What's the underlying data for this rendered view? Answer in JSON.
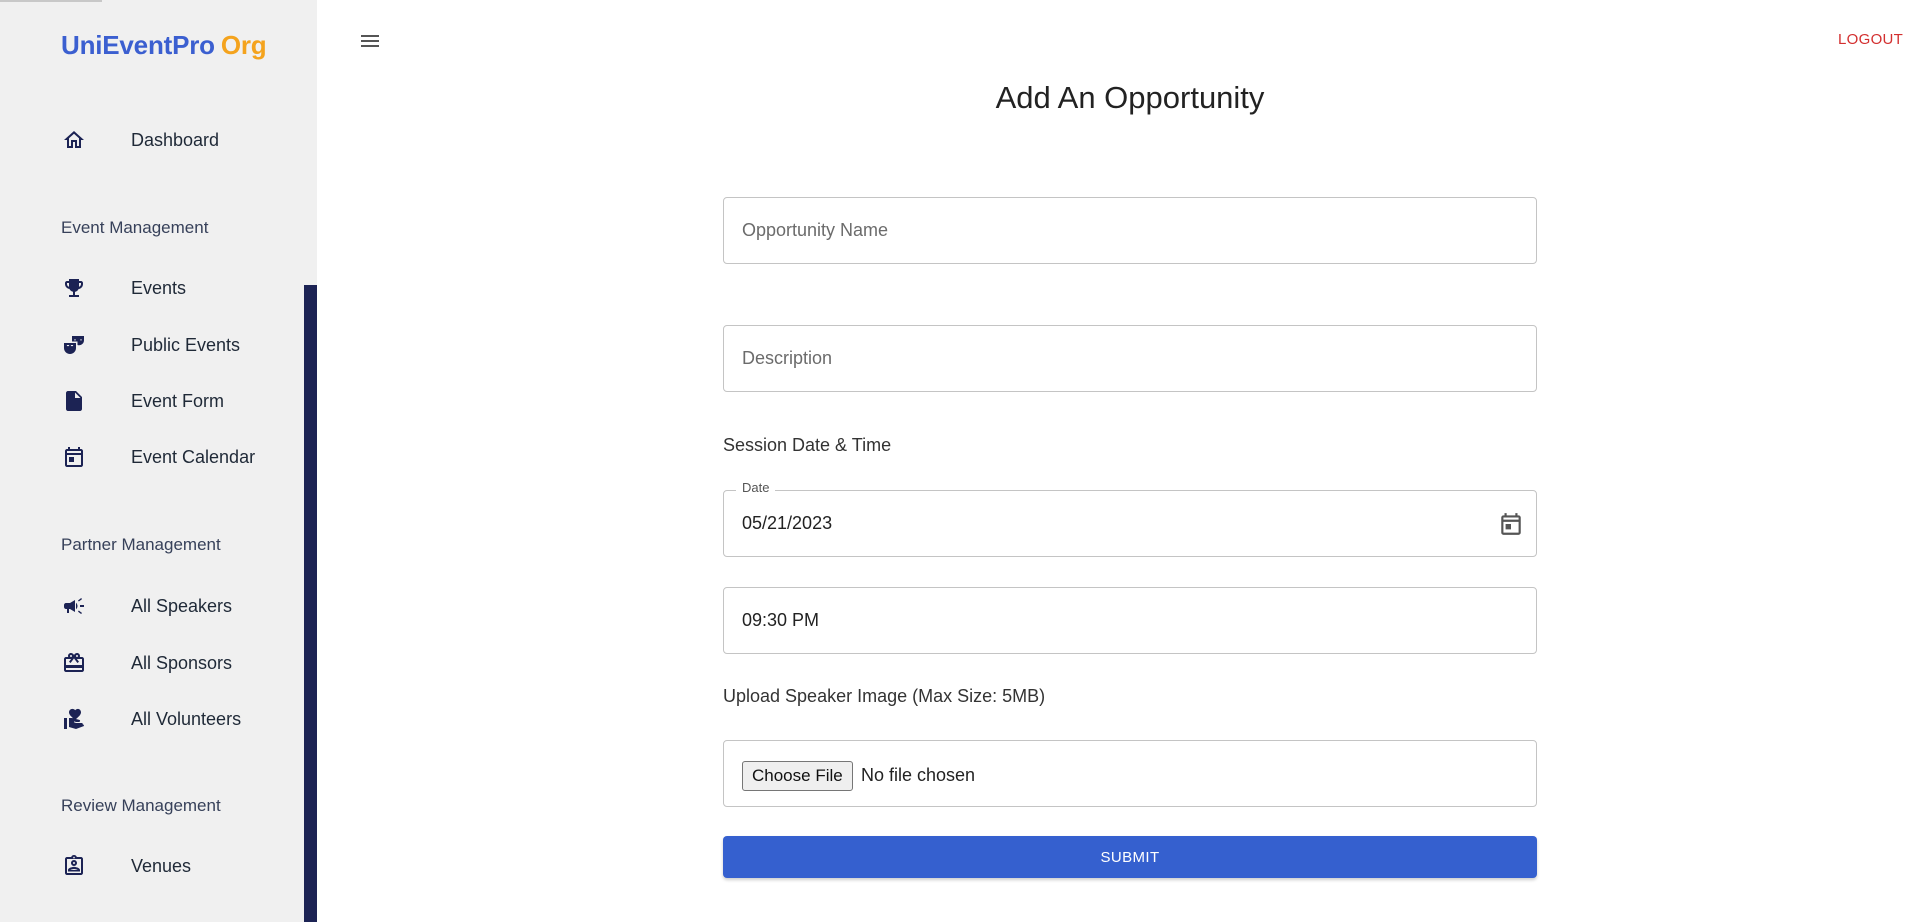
{
  "brand": {
    "name": "UniEventPro",
    "suffix": "Org",
    "name_color": "#3b5fd0",
    "suffix_color": "#f4a31d"
  },
  "sidebar": {
    "dashboard": {
      "label": "Dashboard",
      "icon": "home-icon"
    },
    "sections": [
      {
        "title": "Event Management",
        "items": [
          {
            "label": "Events",
            "icon": "trophy-icon"
          },
          {
            "label": "Public Events",
            "icon": "theater-masks-icon"
          },
          {
            "label": "Event Form",
            "icon": "document-icon"
          },
          {
            "label": "Event Calendar",
            "icon": "calendar-icon"
          }
        ]
      },
      {
        "title": "Partner Management",
        "items": [
          {
            "label": "All Speakers",
            "icon": "megaphone-icon"
          },
          {
            "label": "All Sponsors",
            "icon": "gift-card-icon"
          },
          {
            "label": "All Volunteers",
            "icon": "hand-heart-icon"
          }
        ]
      },
      {
        "title": "Review Management",
        "items": [
          {
            "label": "Venues",
            "icon": "contact-badge-icon"
          }
        ]
      }
    ]
  },
  "header": {
    "logout_label": "LOGOUT",
    "menu_icon": "hamburger-menu-icon"
  },
  "form": {
    "title": "Add An Opportunity",
    "opportunity_name_placeholder": "Opportunity Name",
    "description_placeholder": "Description",
    "session_label": "Session Date & Time",
    "date_label": "Date",
    "date_value": "05/21/2023",
    "time_value": "09:30 PM",
    "upload_label": "Upload Speaker Image (Max Size: 5MB)",
    "choose_file_label": "Choose File",
    "file_status": "No file chosen",
    "submit_label": "SUBMIT"
  },
  "colors": {
    "accent": "#3560cf",
    "sidebar_bg": "#f0f0f0",
    "sidebar_icon": "#1c2354",
    "logout": "#d32f2f"
  }
}
